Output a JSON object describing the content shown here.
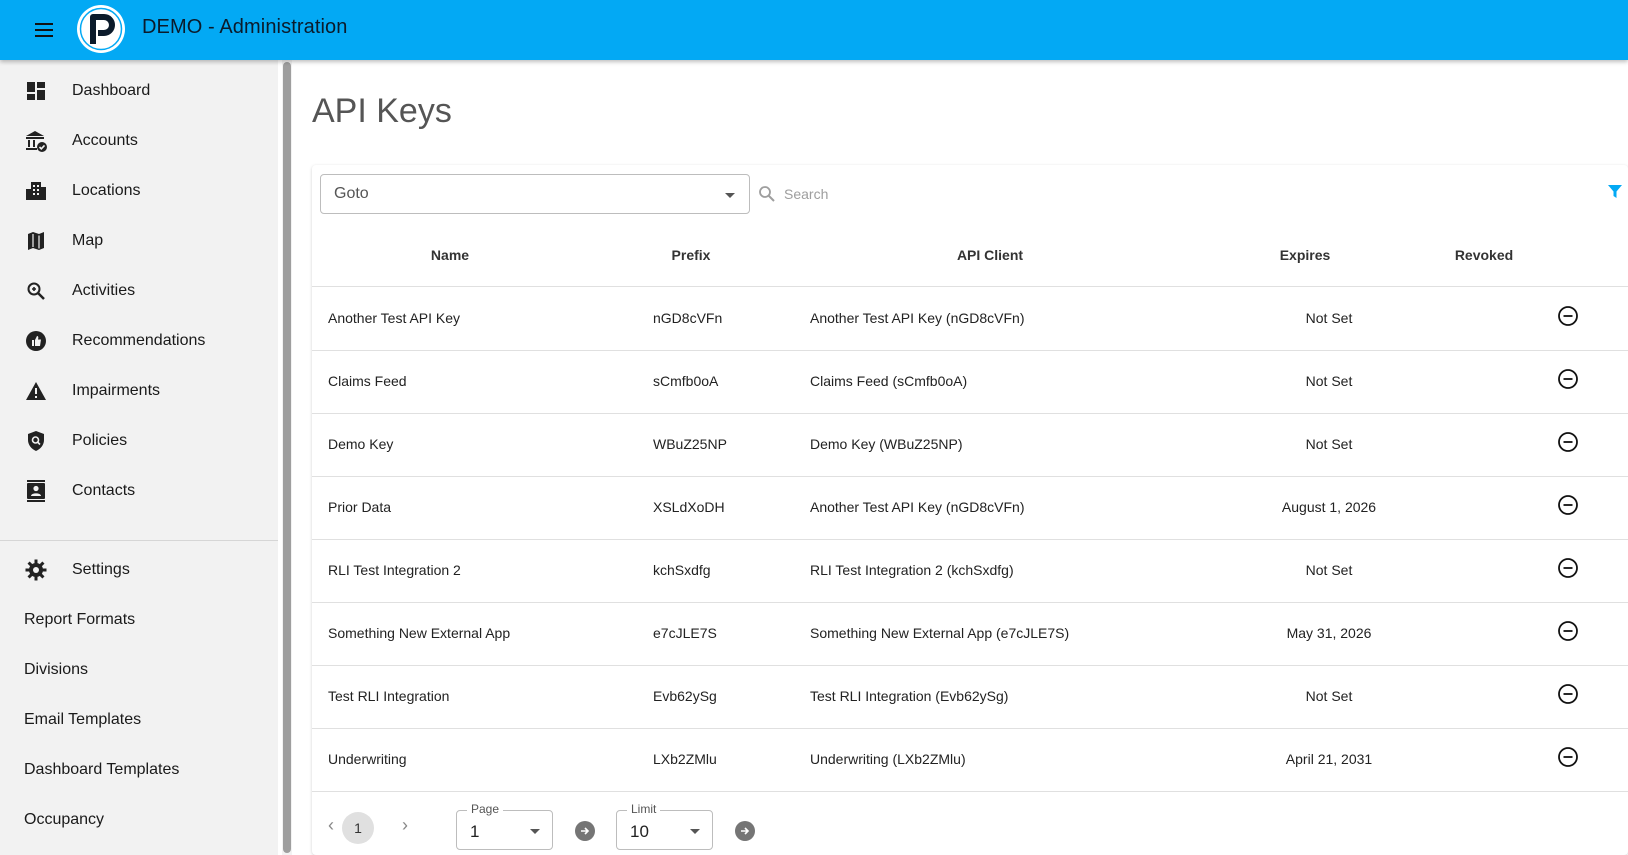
{
  "app": {
    "title": "DEMO - Administration"
  },
  "sidebar": {
    "items": [
      {
        "label": "Dashboard",
        "icon": "dashboard-icon"
      },
      {
        "label": "Accounts",
        "icon": "accounts-icon"
      },
      {
        "label": "Locations",
        "icon": "locations-icon"
      },
      {
        "label": "Map",
        "icon": "map-icon"
      },
      {
        "label": "Activities",
        "icon": "activities-icon"
      },
      {
        "label": "Recommendations",
        "icon": "recommendations-icon"
      },
      {
        "label": "Impairments",
        "icon": "warning-icon"
      },
      {
        "label": "Policies",
        "icon": "policies-icon"
      },
      {
        "label": "Contacts",
        "icon": "contacts-icon"
      }
    ],
    "settings": {
      "label": "Settings",
      "icon": "gear-icon"
    },
    "sub_items": [
      {
        "label": "Report Formats"
      },
      {
        "label": "Divisions"
      },
      {
        "label": "Email Templates"
      },
      {
        "label": "Dashboard Templates"
      },
      {
        "label": "Occupancy"
      }
    ]
  },
  "main": {
    "title": "API Keys",
    "goto": {
      "value": "Goto"
    },
    "search": {
      "placeholder": "Search"
    },
    "table": {
      "headers": {
        "name": "Name",
        "prefix": "Prefix",
        "client": "API Client",
        "expires": "Expires",
        "revoked": "Revoked"
      },
      "rows": [
        {
          "name": "Another Test API Key",
          "prefix": "nGD8cVFn",
          "client": "Another Test API Key (nGD8cVFn)",
          "expires": "Not Set"
        },
        {
          "name": "Claims Feed",
          "prefix": "sCmfb0oA",
          "client": "Claims Feed (sCmfb0oA)",
          "expires": "Not Set"
        },
        {
          "name": "Demo Key",
          "prefix": "WBuZ25NP",
          "client": "Demo Key (WBuZ25NP)",
          "expires": "Not Set"
        },
        {
          "name": "Prior Data",
          "prefix": "XSLdXoDH",
          "client": "Another Test API Key (nGD8cVFn)",
          "expires": "August 1, 2026"
        },
        {
          "name": "RLI Test Integration 2",
          "prefix": "kchSxdfg",
          "client": "RLI Test Integration 2 (kchSxdfg)",
          "expires": "Not Set"
        },
        {
          "name": "Something New External App",
          "prefix": "e7cJLE7S",
          "client": "Something New External App (e7cJLE7S)",
          "expires": "May 31, 2026"
        },
        {
          "name": "Test RLI Integration",
          "prefix": "Evb62ySg",
          "client": "Test RLI Integration (Evb62ySg)",
          "expires": "Not Set"
        },
        {
          "name": "Underwriting",
          "prefix": "LXb2ZMlu",
          "client": "Underwriting (LXb2ZMlu)",
          "expires": "April 21, 2031"
        }
      ]
    },
    "pagination": {
      "current_page": "1",
      "page_label": "Page",
      "page_value": "1",
      "limit_label": "Limit",
      "limit_value": "10"
    }
  },
  "colors": {
    "appbar": "#03a9f4",
    "filter": "#03a9f4",
    "sidebar_bg": "#f2f2f2"
  }
}
